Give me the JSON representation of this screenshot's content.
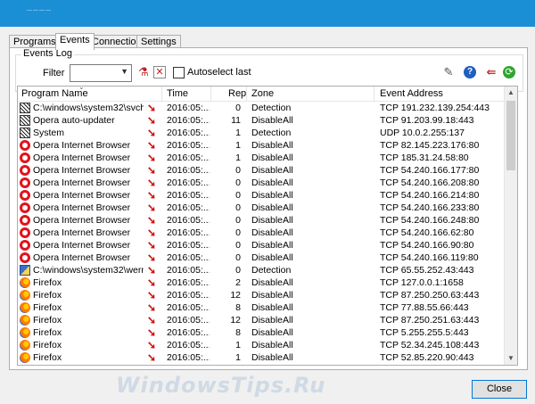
{
  "window": {
    "title": "————"
  },
  "tabs": [
    {
      "label": "Programs",
      "active": false
    },
    {
      "label": "Events",
      "active": true
    },
    {
      "label": "Connections",
      "active": false
    },
    {
      "label": "Settings",
      "active": false
    }
  ],
  "events_log": {
    "group_label": "Events Log",
    "filter_label": "Filter",
    "filter_value": "",
    "autoselect_label": "Autoselect last",
    "autoselect_checked": false
  },
  "table": {
    "columns": [
      "Program Name",
      "Time",
      "Rep",
      "Zone",
      "Event Address"
    ],
    "rows": [
      {
        "icon": "svchost-icon",
        "program": "C:\\windows\\system32\\svch...",
        "time": "2016:05:...",
        "rep": "0",
        "zone": "Detection",
        "address": "TCP 191.232.139.254:443"
      },
      {
        "icon": "svchost-icon",
        "program": "Opera auto-updater",
        "time": "2016:05:...",
        "rep": "11",
        "zone": "DisableAll",
        "address": "TCP 91.203.99.18:443"
      },
      {
        "icon": "svchost-icon",
        "program": "System",
        "time": "2016:05:...",
        "rep": "1",
        "zone": "Detection",
        "address": "UDP 10.0.2.255:137"
      },
      {
        "icon": "opera-icon",
        "program": "Opera Internet Browser",
        "time": "2016:05:...",
        "rep": "1",
        "zone": "DisableAll",
        "address": "TCP 82.145.223.176:80"
      },
      {
        "icon": "opera-icon",
        "program": "Opera Internet Browser",
        "time": "2016:05:...",
        "rep": "1",
        "zone": "DisableAll",
        "address": "TCP 185.31.24.58:80"
      },
      {
        "icon": "opera-icon",
        "program": "Opera Internet Browser",
        "time": "2016:05:...",
        "rep": "0",
        "zone": "DisableAll",
        "address": "TCP 54.240.166.177:80"
      },
      {
        "icon": "opera-icon",
        "program": "Opera Internet Browser",
        "time": "2016:05:...",
        "rep": "0",
        "zone": "DisableAll",
        "address": "TCP 54.240.166.208:80"
      },
      {
        "icon": "opera-icon",
        "program": "Opera Internet Browser",
        "time": "2016:05:...",
        "rep": "0",
        "zone": "DisableAll",
        "address": "TCP 54.240.166.214:80"
      },
      {
        "icon": "opera-icon",
        "program": "Opera Internet Browser",
        "time": "2016:05:...",
        "rep": "0",
        "zone": "DisableAll",
        "address": "TCP 54.240.166.233:80"
      },
      {
        "icon": "opera-icon",
        "program": "Opera Internet Browser",
        "time": "2016:05:...",
        "rep": "0",
        "zone": "DisableAll",
        "address": "TCP 54.240.166.248:80"
      },
      {
        "icon": "opera-icon",
        "program": "Opera Internet Browser",
        "time": "2016:05:...",
        "rep": "0",
        "zone": "DisableAll",
        "address": "TCP 54.240.166.62:80"
      },
      {
        "icon": "opera-icon",
        "program": "Opera Internet Browser",
        "time": "2016:05:...",
        "rep": "0",
        "zone": "DisableAll",
        "address": "TCP 54.240.166.90:80"
      },
      {
        "icon": "opera-icon",
        "program": "Opera Internet Browser",
        "time": "2016:05:...",
        "rep": "0",
        "zone": "DisableAll",
        "address": "TCP 54.240.166.119:80"
      },
      {
        "icon": "wermgr-icon",
        "program": "C:\\windows\\system32\\werm...",
        "time": "2016:05:...",
        "rep": "0",
        "zone": "Detection",
        "address": "TCP 65.55.252.43:443"
      },
      {
        "icon": "firefox-icon",
        "program": "Firefox",
        "time": "2016:05:...",
        "rep": "2",
        "zone": "DisableAll",
        "address": "TCP 127.0.0.1:1658"
      },
      {
        "icon": "firefox-icon",
        "program": "Firefox",
        "time": "2016:05:...",
        "rep": "12",
        "zone": "DisableAll",
        "address": "TCP 87.250.250.63:443"
      },
      {
        "icon": "firefox-icon",
        "program": "Firefox",
        "time": "2016:05:...",
        "rep": "8",
        "zone": "DisableAll",
        "address": "TCP 77.88.55.66:443"
      },
      {
        "icon": "firefox-icon",
        "program": "Firefox",
        "time": "2016:05:...",
        "rep": "12",
        "zone": "DisableAll",
        "address": "TCP 87.250.251.63:443"
      },
      {
        "icon": "firefox-icon",
        "program": "Firefox",
        "time": "2016:05:...",
        "rep": "8",
        "zone": "DisableAll",
        "address": "TCP 5.255.255.5:443"
      },
      {
        "icon": "firefox-icon",
        "program": "Firefox",
        "time": "2016:05:...",
        "rep": "1",
        "zone": "DisableAll",
        "address": "TCP 52.34.245.108:443"
      },
      {
        "icon": "firefox-icon",
        "program": "Firefox",
        "time": "2016:05:...",
        "rep": "1",
        "zone": "DisableAll",
        "address": "TCP 52.85.220.90:443"
      }
    ]
  },
  "footer": {
    "close_label": "Close",
    "watermark": "WindowsTips.Ru"
  },
  "colors": {
    "accent": "#1a8fd6",
    "direction_arrow": "#d01010"
  }
}
